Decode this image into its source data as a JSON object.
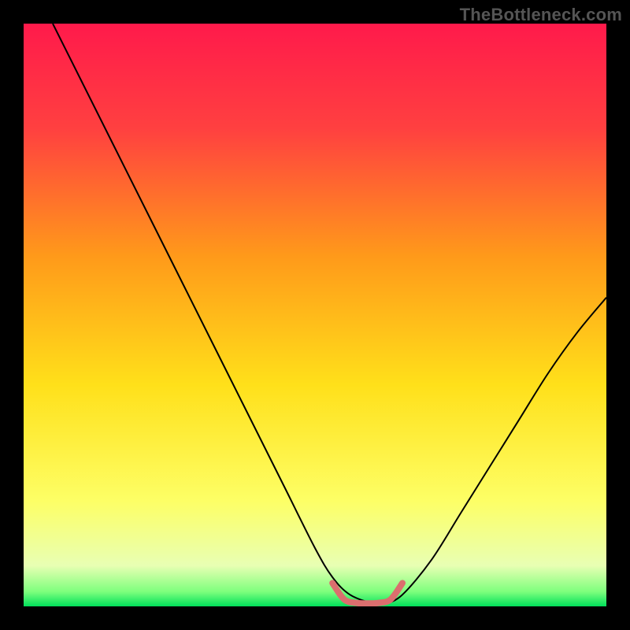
{
  "watermark": "TheBottleneck.com",
  "chart_data": {
    "type": "line",
    "title": "",
    "xlabel": "",
    "ylabel": "",
    "xlim": [
      0,
      100
    ],
    "ylim": [
      0,
      100
    ],
    "grid": false,
    "background_gradient": {
      "stops": [
        {
          "offset": 0.0,
          "color": "#ff1a4b"
        },
        {
          "offset": 0.18,
          "color": "#ff4040"
        },
        {
          "offset": 0.4,
          "color": "#ff9a1a"
        },
        {
          "offset": 0.62,
          "color": "#ffe01a"
        },
        {
          "offset": 0.82,
          "color": "#fdff66"
        },
        {
          "offset": 0.93,
          "color": "#e8ffb3"
        },
        {
          "offset": 0.975,
          "color": "#7dff7d"
        },
        {
          "offset": 1.0,
          "color": "#00e05a"
        }
      ]
    },
    "series": [
      {
        "name": "bottleneck-curve",
        "color": "#000000",
        "width": 2,
        "x": [
          5,
          10,
          15,
          20,
          25,
          30,
          35,
          40,
          45,
          50,
          53,
          56,
          60,
          62,
          65,
          70,
          75,
          80,
          85,
          90,
          95,
          100
        ],
        "y": [
          100,
          90,
          80,
          70,
          60,
          50,
          40,
          30,
          20,
          10,
          5,
          2,
          0.5,
          0.5,
          2,
          8,
          16,
          24,
          32,
          40,
          47,
          53
        ]
      },
      {
        "name": "optimal-flat-marker",
        "color": "#db6e6e",
        "width": 8,
        "linecap": "round",
        "x": [
          53,
          55,
          57,
          59,
          61,
          63,
          65
        ],
        "y": [
          4,
          1.2,
          0.6,
          0.5,
          0.6,
          1.2,
          4
        ]
      }
    ]
  }
}
